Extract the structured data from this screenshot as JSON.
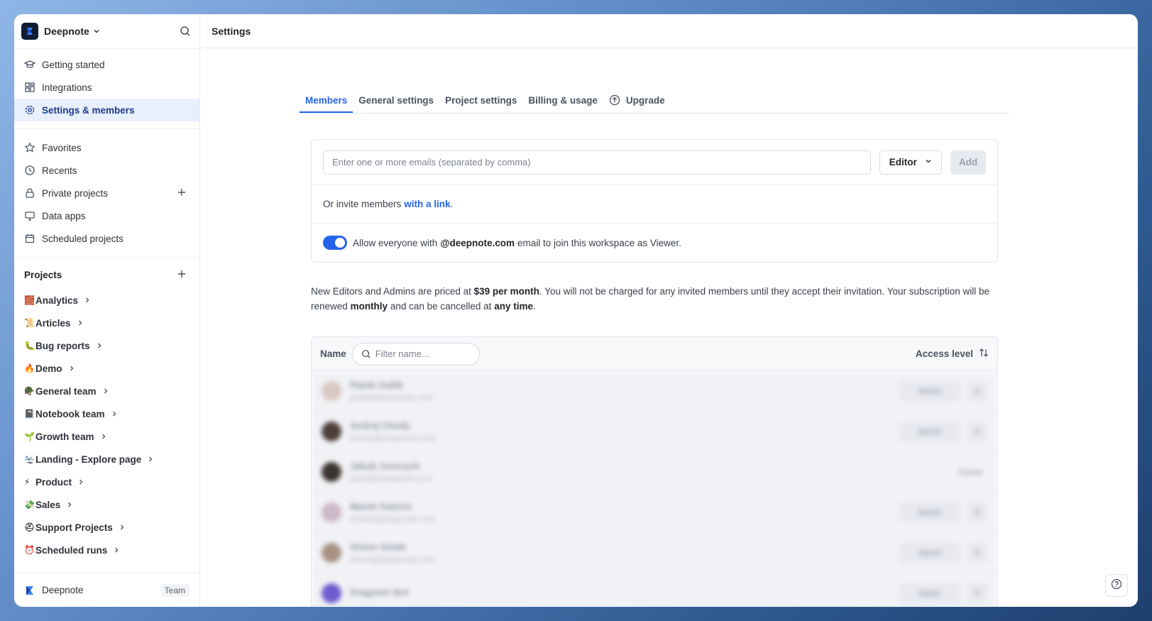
{
  "workspace": {
    "name": "Deepnote"
  },
  "nav": {
    "primary": [
      {
        "label": "Getting started",
        "icon": "graduation-cap-icon"
      },
      {
        "label": "Integrations",
        "icon": "grid-icon"
      },
      {
        "label": "Settings & members",
        "icon": "gear-icon",
        "active": true
      }
    ],
    "secondary": [
      {
        "label": "Favorites",
        "icon": "star-icon"
      },
      {
        "label": "Recents",
        "icon": "clock-icon"
      },
      {
        "label": "Private projects",
        "icon": "lock-icon"
      },
      {
        "label": "Data apps",
        "icon": "monitor-icon"
      },
      {
        "label": "Scheduled projects",
        "icon": "calendar-icon"
      }
    ]
  },
  "projects": {
    "title": "Projects",
    "items": [
      {
        "emoji": "🧱",
        "label": "Analytics"
      },
      {
        "emoji": "📜",
        "label": "Articles"
      },
      {
        "emoji": "🐛",
        "label": "Bug reports"
      },
      {
        "emoji": "🔥",
        "label": "Demo"
      },
      {
        "emoji": "🪖",
        "label": "General team"
      },
      {
        "emoji": "📓",
        "label": "Notebook team"
      },
      {
        "emoji": "🌱",
        "label": "Growth team"
      },
      {
        "emoji": "🛬",
        "label": "Landing - Explore page"
      },
      {
        "emoji": "⚡",
        "label": "Product"
      },
      {
        "emoji": "💸",
        "label": "Sales"
      },
      {
        "emoji": "⛑",
        "label": "Support Projects"
      },
      {
        "emoji": "⏰",
        "label": "Scheduled runs"
      }
    ]
  },
  "footer": {
    "name": "Deepnote",
    "plan": "Team"
  },
  "topbar": {
    "title": "Settings"
  },
  "tabs": {
    "members": "Members",
    "general": "General settings",
    "project": "Project settings",
    "billing": "Billing & usage",
    "upgrade": "Upgrade"
  },
  "invite": {
    "placeholder": "Enter one or more emails (separated by comma)",
    "role": "Editor",
    "add": "Add",
    "link_prefix": "Or invite members",
    "link_text": "with a link",
    "link_suffix": ".",
    "toggle_prefix": "Allow everyone with",
    "toggle_domain": "@deepnote.com",
    "toggle_suffix": "email to join this workspace as Viewer.",
    "toggle_on": true
  },
  "pricing": {
    "p1": "New Editors and Admins are priced at",
    "price": "$39 per month",
    "p2": ". You will not be charged for any invited members until they accept their invitation. Your subscription will be renewed",
    "period": "monthly",
    "p3": "and can be cancelled at",
    "when": "any time",
    "p4": "."
  },
  "members_table": {
    "name_header": "Name",
    "filter_placeholder": "Filter name...",
    "access_header": "Access level",
    "rows": [
      {
        "name": "Patrik Gallik",
        "email": "patrik@deepnote.com",
        "role": "Admin"
      },
      {
        "name": "Andrej Chudy",
        "email": "andrej@deepnote.com",
        "role": "Admin"
      },
      {
        "name": "Jakub Jurovych",
        "email": "jakub@deepnote.com",
        "role": "Owner"
      },
      {
        "name": "Marek Galovic",
        "email": "marek@deepnote.com",
        "role": "Admin"
      },
      {
        "name": "Simon Sotak",
        "email": "simon@deepnote.com",
        "role": "Admin"
      },
      {
        "name": "Dragomir Bot",
        "email": "",
        "role": "Editor"
      }
    ]
  },
  "colors": {
    "accent": "#2563eb",
    "active_bg": "#e8f0fd"
  }
}
